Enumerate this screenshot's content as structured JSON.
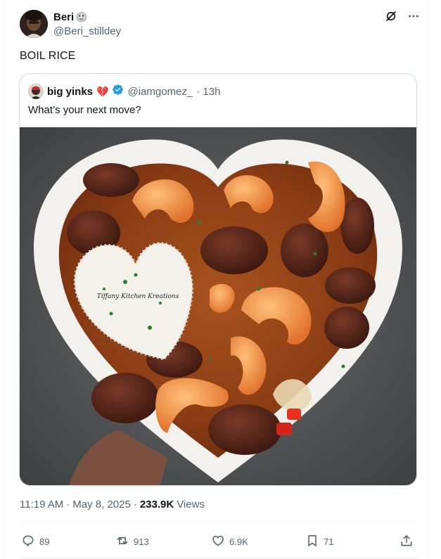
{
  "tweet": {
    "author_name": "Beri",
    "author_emoji": "🙂",
    "author_handle": "@Beri_stilldey",
    "text": "BOIL RICE",
    "time": "11:19 AM",
    "date": "May 8, 2025",
    "views_count": "233.9K",
    "views_label": "Views",
    "meta_sep": "·"
  },
  "quote": {
    "name": "big yinks",
    "name_emoji": "💔",
    "verified": true,
    "handle": "@iamgomez_",
    "time": "· 13h",
    "text": "What’s your next move?",
    "watermark": "Tiffany Kitchen Kreations"
  },
  "actions": {
    "replies": "89",
    "reposts": "913",
    "likes": "6.9K",
    "bookmarks": "71"
  },
  "colors": {
    "text": "#0f1419",
    "muted": "#536471",
    "verified": "#1d9bf0",
    "border": "#cfd9de"
  },
  "icons": [
    "grok-icon",
    "more-icon",
    "reply-icon",
    "repost-icon",
    "like-icon",
    "bookmark-icon",
    "share-icon",
    "verified-badge-icon"
  ]
}
